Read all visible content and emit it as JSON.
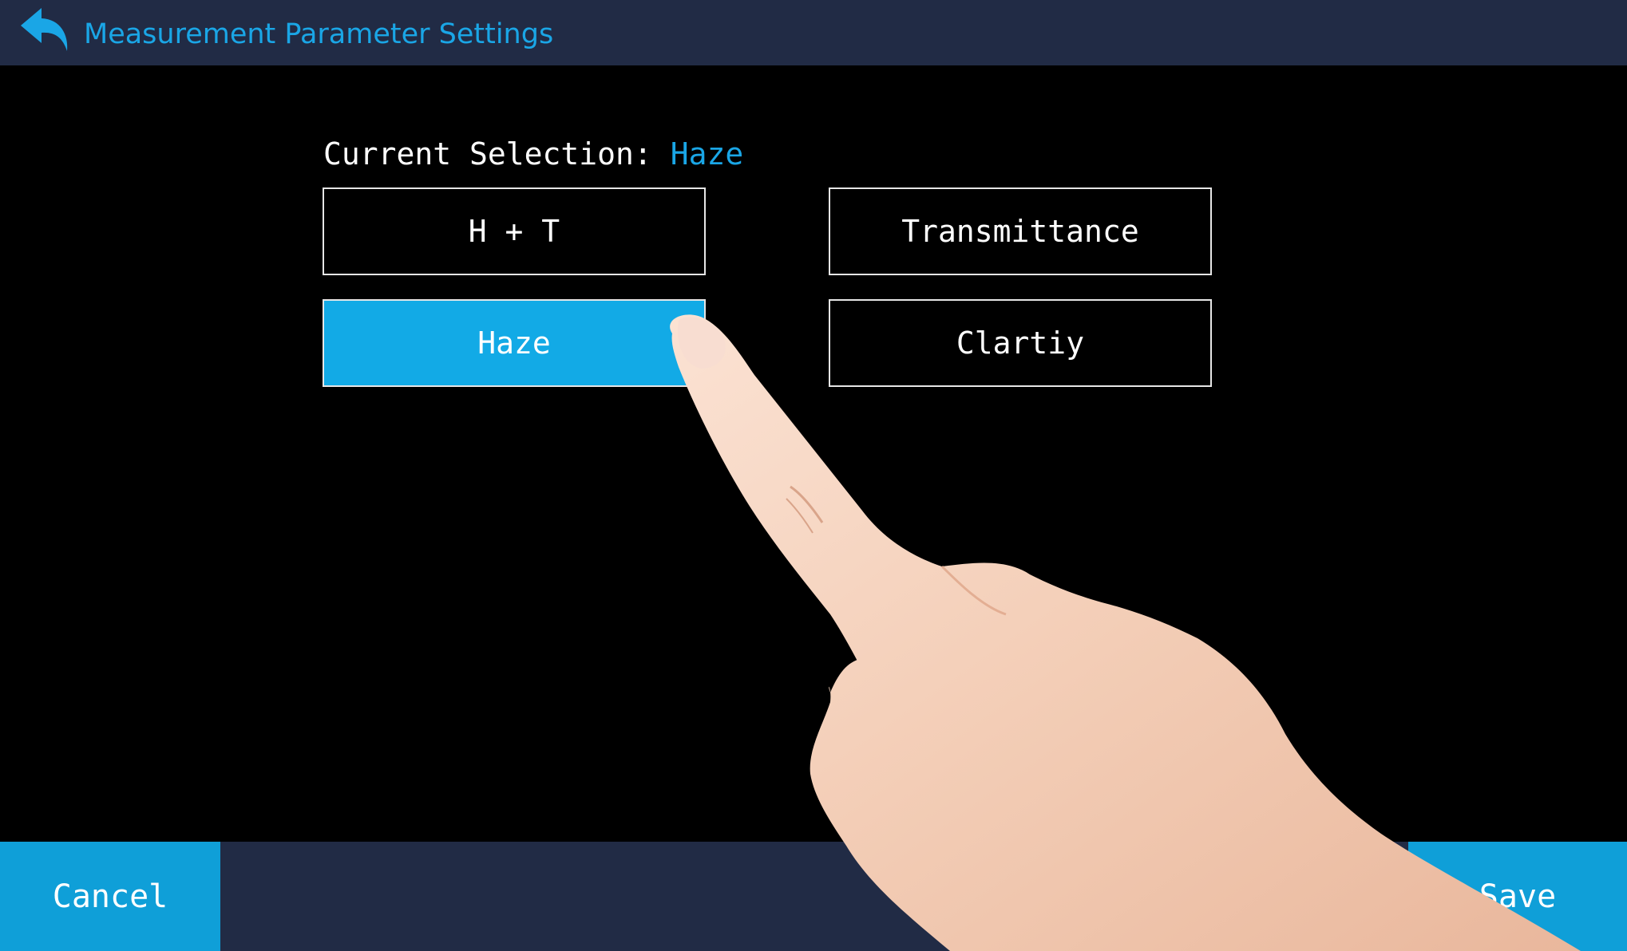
{
  "header": {
    "back_icon": "back-arrow-icon",
    "title": "Measurement Parameter Settings"
  },
  "selection": {
    "label": "Current Selection: ",
    "value": "Haze"
  },
  "options": {
    "ht": "H + T",
    "transmittance": "Transmittance",
    "haze": "Haze",
    "clarity": "Clartiy"
  },
  "footer": {
    "cancel_label": "Cancel",
    "save_label": "Save"
  },
  "colors": {
    "accent": "#12aae6",
    "bar": "#212b45",
    "background": "#000000"
  }
}
